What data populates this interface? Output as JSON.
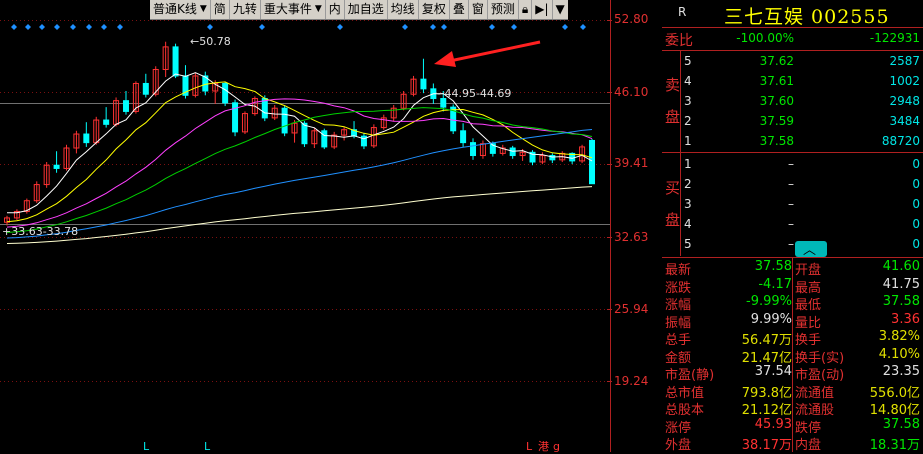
{
  "toolbar": {
    "items": [
      {
        "label": "普通K线",
        "dropdown": true
      },
      {
        "label": "简"
      },
      {
        "label": "九转"
      },
      {
        "label": "重大事件",
        "dropdown": true
      },
      {
        "label": "内"
      },
      {
        "label": "加自选"
      },
      {
        "label": "均线"
      },
      {
        "label": "复权"
      },
      {
        "label": "叠"
      },
      {
        "label": "窗"
      },
      {
        "label": "预测"
      }
    ]
  },
  "price_axis": [
    "52.80",
    "46.10",
    "39.41",
    "32.63",
    "25.94",
    "19.24"
  ],
  "chart_annotations": {
    "high_label": "50.78",
    "low_label": "33.63-33.78",
    "range_label": "44.95-44.69",
    "bottom_markers": [
      "L",
      "L",
      "L",
      "港",
      "g"
    ]
  },
  "chart_data": {
    "type": "candlestick",
    "title": "",
    "ylim": [
      19.24,
      52.8
    ],
    "yticks": [
      52.8,
      46.1,
      39.41,
      32.63,
      25.94,
      19.24
    ],
    "colors": {
      "up": "#ff3232",
      "down": "#00ffff",
      "ma5": "#ffffff",
      "ma10": "#ffff00",
      "ma20": "#ff40ff",
      "ma30": "#00d000",
      "ma60": "#2090ff",
      "ma120": "#ffffd0"
    },
    "candles": [
      [
        34.0,
        34.6,
        33.7,
        34.4
      ],
      [
        34.4,
        35.2,
        34.2,
        35.0
      ],
      [
        35.0,
        36.2,
        34.8,
        36.0
      ],
      [
        36.0,
        37.8,
        35.8,
        37.5
      ],
      [
        37.5,
        39.6,
        37.2,
        39.3
      ],
      [
        39.3,
        40.6,
        38.6,
        39.0
      ],
      [
        39.0,
        41.2,
        38.8,
        40.9
      ],
      [
        40.9,
        42.5,
        40.4,
        42.2
      ],
      [
        42.2,
        43.3,
        41.0,
        41.4
      ],
      [
        41.4,
        43.8,
        41.2,
        43.5
      ],
      [
        43.5,
        44.7,
        42.8,
        43.1
      ],
      [
        43.1,
        45.6,
        42.9,
        45.3
      ],
      [
        45.3,
        46.2,
        44.0,
        44.3
      ],
      [
        44.3,
        47.1,
        44.1,
        46.9
      ],
      [
        46.9,
        47.8,
        45.6,
        45.9
      ],
      [
        45.9,
        48.5,
        45.7,
        48.2
      ],
      [
        48.2,
        50.78,
        47.5,
        50.3
      ],
      [
        50.3,
        50.6,
        47.4,
        47.6
      ],
      [
        47.6,
        48.6,
        45.5,
        45.8
      ],
      [
        45.8,
        47.9,
        45.6,
        47.6
      ],
      [
        47.6,
        48.0,
        45.8,
        46.2
      ],
      [
        46.2,
        47.2,
        45.0,
        46.9
      ],
      [
        46.9,
        47.0,
        44.8,
        45.1
      ],
      [
        45.1,
        45.4,
        42.0,
        42.4
      ],
      [
        42.4,
        44.3,
        42.2,
        44.1
      ],
      [
        44.1,
        45.7,
        43.9,
        45.5
      ],
      [
        45.5,
        45.8,
        43.4,
        43.7
      ],
      [
        43.7,
        44.9,
        43.5,
        44.6
      ],
      [
        44.6,
        44.8,
        42.0,
        42.3
      ],
      [
        42.3,
        43.5,
        41.4,
        43.2
      ],
      [
        43.2,
        43.4,
        41.0,
        41.3
      ],
      [
        41.3,
        42.8,
        40.9,
        42.5
      ],
      [
        42.5,
        42.7,
        40.8,
        41.0
      ],
      [
        41.0,
        42.4,
        40.8,
        42.1
      ],
      [
        42.1,
        42.9,
        41.6,
        42.6
      ],
      [
        42.6,
        43.4,
        41.8,
        42.0
      ],
      [
        42.0,
        42.3,
        40.8,
        41.1
      ],
      [
        41.1,
        43.1,
        40.9,
        42.8
      ],
      [
        42.8,
        44.0,
        42.6,
        43.7
      ],
      [
        43.7,
        44.9,
        43.4,
        44.6
      ],
      [
        44.6,
        46.2,
        44.4,
        45.9
      ],
      [
        45.9,
        47.6,
        45.7,
        47.3
      ],
      [
        47.3,
        49.2,
        46.0,
        46.4
      ],
      [
        46.4,
        46.9,
        45.0,
        45.5
      ],
      [
        45.5,
        46.2,
        44.3,
        44.7
      ],
      [
        44.7,
        44.95,
        42.2,
        42.5
      ],
      [
        42.5,
        43.2,
        41.0,
        41.4
      ],
      [
        41.4,
        41.8,
        39.8,
        40.2
      ],
      [
        40.2,
        41.6,
        39.9,
        41.3
      ],
      [
        41.3,
        41.5,
        40.1,
        40.4
      ],
      [
        40.4,
        41.2,
        40.2,
        40.9
      ],
      [
        40.9,
        41.1,
        39.9,
        40.2
      ],
      [
        40.2,
        40.8,
        39.7,
        40.5
      ],
      [
        40.5,
        40.7,
        39.3,
        39.6
      ],
      [
        39.6,
        40.5,
        39.4,
        40.2
      ],
      [
        40.2,
        40.4,
        39.5,
        39.8
      ],
      [
        39.8,
        40.6,
        39.6,
        40.4
      ],
      [
        40.4,
        40.5,
        39.4,
        39.7
      ],
      [
        39.7,
        41.2,
        39.5,
        41.0
      ],
      [
        41.6,
        41.75,
        37.58,
        37.58
      ]
    ]
  },
  "quote": {
    "market_tag": "R",
    "title": "三七互娱 002555",
    "weibi": {
      "label": "委比",
      "pct": "-100.00%",
      "diff": "-122931"
    },
    "sell_label": "卖盘",
    "buy_label": "买盘",
    "asks": [
      {
        "level": "5",
        "price": "37.62",
        "vol": "2587"
      },
      {
        "level": "4",
        "price": "37.61",
        "vol": "1002"
      },
      {
        "level": "3",
        "price": "37.60",
        "vol": "2948"
      },
      {
        "level": "2",
        "price": "37.59",
        "vol": "3484"
      },
      {
        "level": "1",
        "price": "37.58",
        "vol": "88720"
      }
    ],
    "bids": [
      {
        "level": "1",
        "price": "–",
        "vol": "0"
      },
      {
        "level": "2",
        "price": "–",
        "vol": "0"
      },
      {
        "level": "3",
        "price": "–",
        "vol": "0"
      },
      {
        "level": "4",
        "price": "–",
        "vol": "0"
      },
      {
        "level": "5",
        "price": "–",
        "vol": "0"
      }
    ],
    "stats": [
      {
        "l1": "最新",
        "v1": "37.58",
        "c1": "grn",
        "l2": "开盘",
        "v2": "41.60",
        "c2": "grn"
      },
      {
        "l1": "涨跌",
        "v1": "-4.17",
        "c1": "grn",
        "l2": "最高",
        "v2": "41.75",
        "c2": "wht"
      },
      {
        "l1": "涨幅",
        "v1": "-9.99%",
        "c1": "grn",
        "l2": "最低",
        "v2": "37.58",
        "c2": "grn"
      },
      {
        "l1": "振幅",
        "v1": "9.99%",
        "c1": "wht",
        "l2": "量比",
        "v2": "3.36",
        "c2": "red"
      },
      {
        "l1": "总手",
        "v1": "56.47万",
        "c1": "yel",
        "l2": "换手",
        "v2": "3.82%",
        "c2": "yel"
      },
      {
        "l1": "金额",
        "v1": "21.47亿",
        "c1": "yel",
        "l2": "换手(实)",
        "v2": "4.10%",
        "c2": "yel"
      },
      {
        "l1": "市盈(静)",
        "v1": "37.54",
        "c1": "wht",
        "l2": "市盈(动)",
        "v2": "23.35",
        "c2": "wht"
      },
      {
        "l1": "总市值",
        "v1": "793.8亿",
        "c1": "yel",
        "l2": "流通值",
        "v2": "556.0亿",
        "c2": "yel"
      },
      {
        "l1": "总股本",
        "v1": "21.12亿",
        "c1": "yel",
        "l2": "流通股",
        "v2": "14.80亿",
        "c2": "yel"
      },
      {
        "l1": "涨停",
        "v1": "45.93",
        "c1": "red",
        "l2": "跌停",
        "v2": "37.58",
        "c2": "grn"
      },
      {
        "l1": "外盘",
        "v1": "38.17万",
        "c1": "red",
        "l2": "内盘",
        "v2": "18.31万",
        "c2": "grn"
      }
    ]
  }
}
